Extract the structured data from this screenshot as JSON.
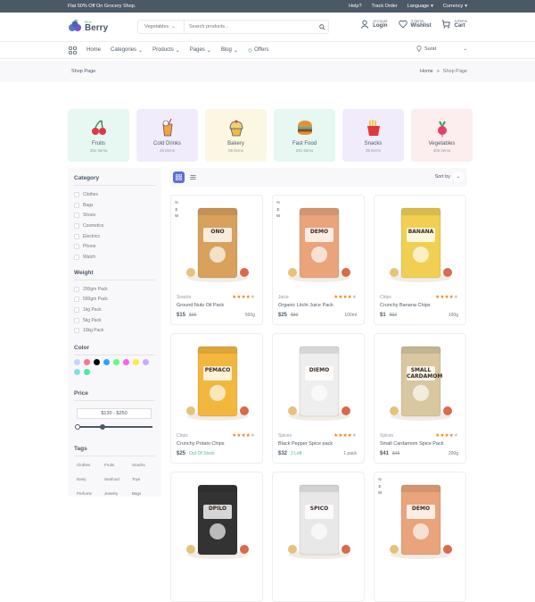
{
  "topbar": {
    "promo": "Flat 50% Off On Grocery Shop.",
    "links": [
      "Help?",
      "Track Order",
      "Language",
      "Currency"
    ]
  },
  "header": {
    "logo_small": "Blue",
    "logo_big": "Berry",
    "search_category": "Vegetables",
    "search_placeholder": "Search products...",
    "account_sub": "Account",
    "account_main": "Login",
    "wishlist_sub": "3 Items",
    "wishlist_main": "Wishlist",
    "cart_sub": "4 items",
    "cart_main": "Cart"
  },
  "nav": {
    "items": [
      "Home",
      "Categories",
      "Products",
      "Pages",
      "Blog",
      "Offers"
    ],
    "location": "Surat"
  },
  "breadcrumb": {
    "title": "Shop Page",
    "home": "Home",
    "sep": "»",
    "current": "Shop Page"
  },
  "categories": [
    {
      "name": "Fruits",
      "count": "291 items",
      "bg": "#e7f7f2",
      "icon": "cherry-icon"
    },
    {
      "name": "Cold Drinks",
      "count": "49 items",
      "bg": "#f0ecfc",
      "icon": "drink-icon"
    },
    {
      "name": "Bakery",
      "count": "08 items",
      "bg": "#fbf7e3",
      "icon": "cupcake-icon"
    },
    {
      "name": "Fast Food",
      "count": "291 items",
      "bg": "#e7f7f2",
      "icon": "burger-icon"
    },
    {
      "name": "Snacks",
      "count": "49 items",
      "bg": "#f0ecfc",
      "icon": "fries-icon"
    },
    {
      "name": "Vegetables",
      "count": "405 items",
      "bg": "#fcedee",
      "icon": "radish-icon"
    }
  ],
  "sidebar": {
    "category_title": "Category",
    "category_items": [
      "Clothes",
      "Bags",
      "Shoes",
      "Cosmetics",
      "Electrics",
      "Phone",
      "Watch"
    ],
    "weight_title": "Weight",
    "weight_items": [
      "200gm Pack",
      "500gm Pack",
      "1kg Pack",
      "5kg Pack",
      "10kg Pack"
    ],
    "color_title": "Color",
    "colors": [
      "#c4d6f9",
      "#ff748b",
      "#000000",
      "#2ea1ff",
      "#5eff72",
      "#ff5eec",
      "#ffeb3b",
      "#ccaaff",
      "#7ce3e3",
      "#53e6a2"
    ],
    "price_title": "Price",
    "price_range": "$130 - $250",
    "price_low_fraction": 0,
    "price_high_fraction": 0.33,
    "tags_title": "Tags",
    "tags": [
      "Clothes",
      "Fruits",
      "Snacks",
      "Dairy",
      "Seafood",
      "Toys",
      "Perfume",
      "Jewelry",
      "Bags"
    ]
  },
  "toolbar": {
    "sort_label": "Sort by"
  },
  "products": [
    {
      "new": true,
      "new_text": "NEW",
      "category": "Snacks",
      "rating": 4,
      "name": "Ground Nuts Oil Pack",
      "price": "$15",
      "old_price": "$25",
      "stock": "",
      "weight": "500g",
      "label": "ONO",
      "pack_color": "#d8a15c",
      "bg": "#ffffff"
    },
    {
      "new": true,
      "new_text": "NEW",
      "category": "Juice",
      "rating": 4,
      "name": "Organic Litchi Juice Pack",
      "price": "$25",
      "old_price": "$30",
      "stock": "",
      "weight": "100ml",
      "label": "DEMO",
      "pack_color": "#e9a47b",
      "bg": "#ffffff"
    },
    {
      "new": false,
      "new_text": "",
      "category": "Chips",
      "rating": 4,
      "name": "Crunchy Banana Chips",
      "price": "$1",
      "old_price": "$02",
      "stock": "",
      "weight": "100g",
      "label": "BANANA",
      "pack_color": "#f0cf52",
      "bg": "#ffffff"
    },
    {
      "new": false,
      "new_text": "",
      "category": "Chips",
      "rating": 4,
      "name": "Crunchy Potato Chips",
      "price": "$25",
      "old_price": "",
      "stock": "Out Of Stock",
      "weight": "",
      "label": "PEMACO",
      "pack_color": "#f3b73d",
      "bg": "#ffffff"
    },
    {
      "new": false,
      "new_text": "",
      "category": "Spices",
      "rating": 4,
      "name": "Black Pepper Spice pack",
      "price": "$32",
      "old_price": "",
      "stock": "2 Left",
      "weight": "1 pack",
      "label": "DIEMO",
      "pack_color": "#eeeeee",
      "bg": "#ffffff"
    },
    {
      "new": false,
      "new_text": "",
      "category": "Spices",
      "rating": 4,
      "name": "Small Cardamom Spice Pack",
      "price": "$41",
      "old_price": "$45",
      "stock": "",
      "weight": "200g",
      "label": "SMALL CARDAMOM",
      "pack_color": "#d9c7a0",
      "bg": "#ffffff"
    },
    {
      "new": false,
      "new_text": "",
      "category": "",
      "rating": 0,
      "name": "",
      "price": "",
      "old_price": "",
      "stock": "",
      "weight": "",
      "label": "DPILO",
      "pack_color": "#333333",
      "bg": "#ffffff"
    },
    {
      "new": false,
      "new_text": "",
      "category": "",
      "rating": 0,
      "name": "",
      "price": "",
      "old_price": "",
      "stock": "",
      "weight": "",
      "label": "SPICO",
      "pack_color": "#e8e8e8",
      "bg": "#ffffff"
    },
    {
      "new": true,
      "new_text": "NEW",
      "category": "",
      "rating": 0,
      "name": "",
      "price": "",
      "old_price": "",
      "stock": "",
      "weight": "",
      "label": "DEMO",
      "pack_color": "#e9a47b",
      "bg": "#ffffff"
    }
  ]
}
